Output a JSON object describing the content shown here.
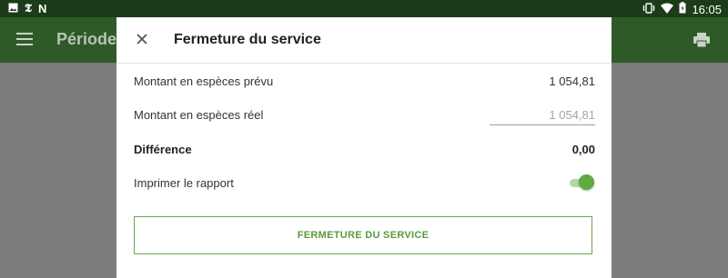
{
  "status_bar": {
    "left_icons": [
      "image-icon",
      "nyt-icon",
      "n-icon"
    ],
    "right_icons": [
      "vibrate-icon",
      "wifi-icon",
      "battery-icon"
    ],
    "time": "16:05"
  },
  "toolbar": {
    "title": "Période d",
    "menu_icon": "menu-icon",
    "print_icon": "print-icon"
  },
  "dialog": {
    "title": "Fermeture du service",
    "close_icon": "close-icon",
    "expected_cash_label": "Montant en espèces prévu",
    "expected_cash_value": "1 054,81",
    "actual_cash_label": "Montant en espèces réel",
    "actual_cash_placeholder": "1 054,81",
    "difference_label": "Différence",
    "difference_value": "0,00",
    "print_report_label": "Imprimer le rapport",
    "print_report_on": true,
    "close_service_button": "FERMETURE DU SERVICE"
  },
  "colors": {
    "status_bar": "#1c3b18",
    "toolbar": "#2e5a28",
    "accent": "#5eac40"
  }
}
